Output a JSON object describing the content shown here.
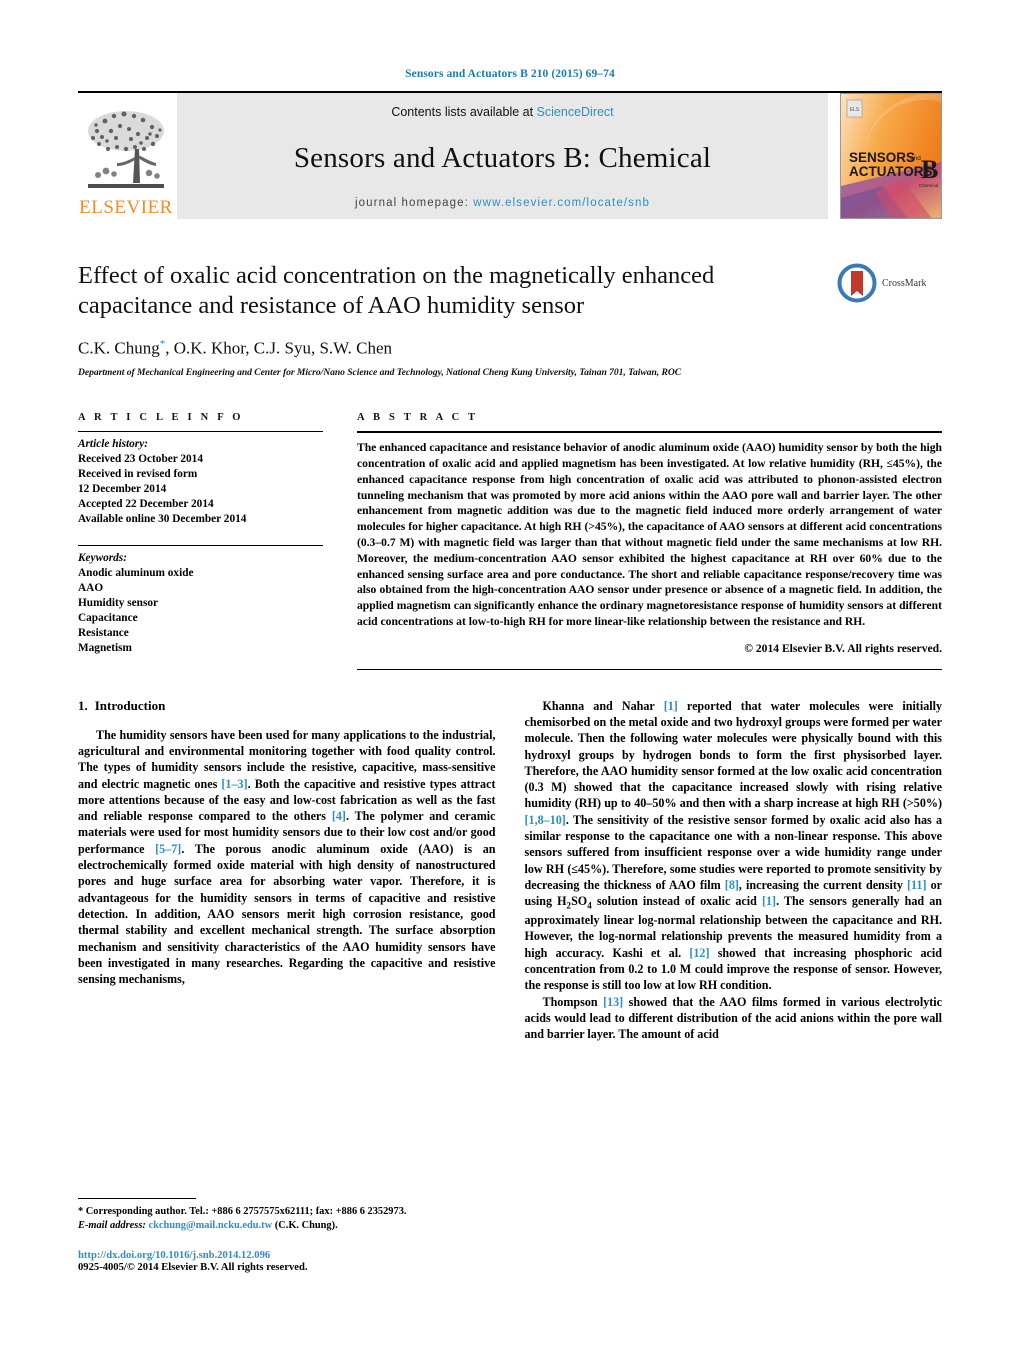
{
  "running_head": "Sensors and Actuators B 210 (2015) 69–74",
  "banner": {
    "publisher_name": "ELSEVIER",
    "contents_prefix": "Contents lists available at ",
    "contents_link": "ScienceDirect",
    "journal_title": "Sensors and Actuators B: Chemical",
    "homepage_prefix": "journal homepage: ",
    "homepage_url": "www.elsevier.com/locate/snb",
    "cover": {
      "line1": "SENSORS",
      "line1_small": "and",
      "line2": "ACTUATORS",
      "letter": "B",
      "letter_sub": "Chemical"
    }
  },
  "article": {
    "title": "Effect of oxalic acid concentration on the magnetically enhanced capacitance and resistance of AAO humidity sensor",
    "authors": "C.K. Chung*, O.K. Khor, C.J. Syu, S.W. Chen",
    "affiliation": "Department of Mechanical Engineering and Center for Micro/Nano Science and Technology, National Cheng Kung University, Tainan 701, Taiwan, ROC",
    "crossmark_label": "CrossMark"
  },
  "article_info": {
    "kicker": "A R T I C L E   I N F O",
    "history_label": "Article history:",
    "history": [
      "Received 23 October 2014",
      "Received in revised form",
      "12 December 2014",
      "Accepted 22 December 2014",
      "Available online 30 December 2014"
    ],
    "keywords_label": "Keywords:",
    "keywords": [
      "Anodic aluminum oxide",
      "AAO",
      "Humidity sensor",
      "Capacitance",
      "Resistance",
      "Magnetism"
    ]
  },
  "abstract": {
    "kicker": "A B S T R A C T",
    "text": "The enhanced capacitance and resistance behavior of anodic aluminum oxide (AAO) humidity sensor by both the high concentration of oxalic acid and applied magnetism has been investigated. At low relative humidity (RH, ≤45%), the enhanced capacitance response from high concentration of oxalic acid was attributed to phonon-assisted electron tunneling mechanism that was promoted by more acid anions within the AAO pore wall and barrier layer. The other enhancement from magnetic addition was due to the magnetic field induced more orderly arrangement of water molecules for higher capacitance. At high RH (>45%), the capacitance of AAO sensors at different acid concentrations (0.3–0.7 M) with magnetic field was larger than that without magnetic field under the same mechanisms at low RH. Moreover, the medium-concentration AAO sensor exhibited the highest capacitance at RH over 60% due to the enhanced sensing surface area and pore conductance. The short and reliable capacitance response/recovery time was also obtained from the high-concentration AAO sensor under presence or absence of a magnetic field. In addition, the applied magnetism can significantly enhance the ordinary magnetoresistance response of humidity sensors at different acid concentrations at low-to-high RH for more linear-like relationship between the resistance and RH.",
    "copyright": "© 2014 Elsevier B.V. All rights reserved."
  },
  "introduction": {
    "number": "1.",
    "heading": "Introduction",
    "left_paragraphs": [
      "The humidity sensors have been used for many applications to the industrial, agricultural and environmental monitoring together with food quality control. The types of humidity sensors include the resistive, capacitive, mass-sensitive and electric magnetic ones [1–3]. Both the capacitive and resistive types attract more attentions because of the easy and low-cost fabrication as well as the fast and reliable response compared to the others [4]. The polymer and ceramic materials were used for most humidity sensors due to their low cost and/or good performance [5–7]. The porous anodic aluminum oxide (AAO) is an electrochemically formed oxide material with high density of nanostructured pores and huge surface area for absorbing water vapor. Therefore, it is advantageous for the humidity sensors in terms of capacitive and resistive detection. In addition, AAO sensors merit high corrosion resistance, good thermal stability and excellent mechanical strength. The surface absorption mechanism and sensitivity characteristics of the AAO humidity sensors have been investigated in many researches. Regarding the capacitive and resistive sensing mechanisms,"
    ],
    "right_paragraphs": [
      "Khanna and Nahar [1] reported that water molecules were initially chemisorbed on the metal oxide and two hydroxyl groups were formed per water molecule. Then the following water molecules were physically bound with this hydroxyl groups by hydrogen bonds to form the first physisorbed layer. Therefore, the AAO humidity sensor formed at the low oxalic acid concentration (0.3 M) showed that the capacitance increased slowly with rising relative humidity (RH) up to 40–50% and then with a sharp increase at high RH (>50%) [1,8–10]. The sensitivity of the resistive sensor formed by oxalic acid also has a similar response to the capacitance one with a non-linear response. This above sensors suffered from insufficient response over a wide humidity range under low RH (≤45%). Therefore, some studies were reported to promote sensitivity by decreasing the thickness of AAO film [8], increasing the current density [11] or using H2SO4 solution instead of oxalic acid [1]. The sensors generally had an approximately linear log-normal relationship between the capacitance and RH. However, the log-normal relationship prevents the measured humidity from a high accuracy. Kashi et al. [12] showed that increasing phosphoric acid concentration from 0.2 to 1.0 M could improve the response of sensor. However, the response is still too low at low RH condition.",
      "Thompson [13] showed that the AAO films formed in various electrolytic acids would lead to different distribution of the acid anions within the pore wall and barrier layer. The amount of acid"
    ]
  },
  "footnote": {
    "corresponding": "* Corresponding author. Tel.: +886 6 2757575x62111; fax: +886 6 2352973.",
    "email_label": "E-mail address:",
    "email": "ckchung@mail.ncku.edu.tw",
    "email_suffix": " (C.K. Chung).",
    "doi": "http://dx.doi.org/10.1016/j.snb.2014.12.096",
    "issn_line": "0925-4005/© 2014 Elsevier B.V. All rights reserved."
  },
  "colors": {
    "link": "#2b8fc4",
    "running_head": "#1a7bb0",
    "elsevier_orange": "#F28C28",
    "banner_bg": "#e8e8e8"
  }
}
